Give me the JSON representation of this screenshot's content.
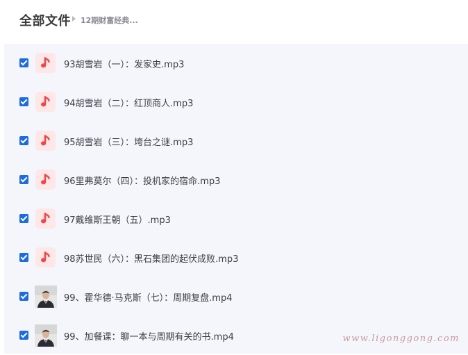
{
  "header": {
    "title": "全部文件",
    "breadcrumb": "12期财富经典..."
  },
  "files": [
    {
      "name": "93胡雪岩（一）：发家史.mp3",
      "type": "audio",
      "checked": true
    },
    {
      "name": "94胡雪岩（二）：红顶商人.mp3",
      "type": "audio",
      "checked": true
    },
    {
      "name": "95胡雪岩（三）：垮台之谜.mp3",
      "type": "audio",
      "checked": true
    },
    {
      "name": "96里弗莫尔（四）：投机家的宿命.mp3",
      "type": "audio",
      "checked": true
    },
    {
      "name": "97戴维斯王朝（五）.mp3",
      "type": "audio",
      "checked": true
    },
    {
      "name": "98苏世民（六）：黑石集团的起伏成败.mp3",
      "type": "audio",
      "checked": true
    },
    {
      "name": "99、霍华德·马克斯（七）：周期复盘.mp4",
      "type": "video",
      "checked": true
    },
    {
      "name": "99、加餐课：聊一本与周期有关的书.mp4",
      "type": "video",
      "checked": true
    }
  ],
  "watermark": "www.ligonggong.com",
  "colors": {
    "accent": "#1c6be0",
    "audio_icon": "#f0474a",
    "audio_icon_bg": "#fde7e7",
    "list_bg": "#f5f6fc"
  }
}
